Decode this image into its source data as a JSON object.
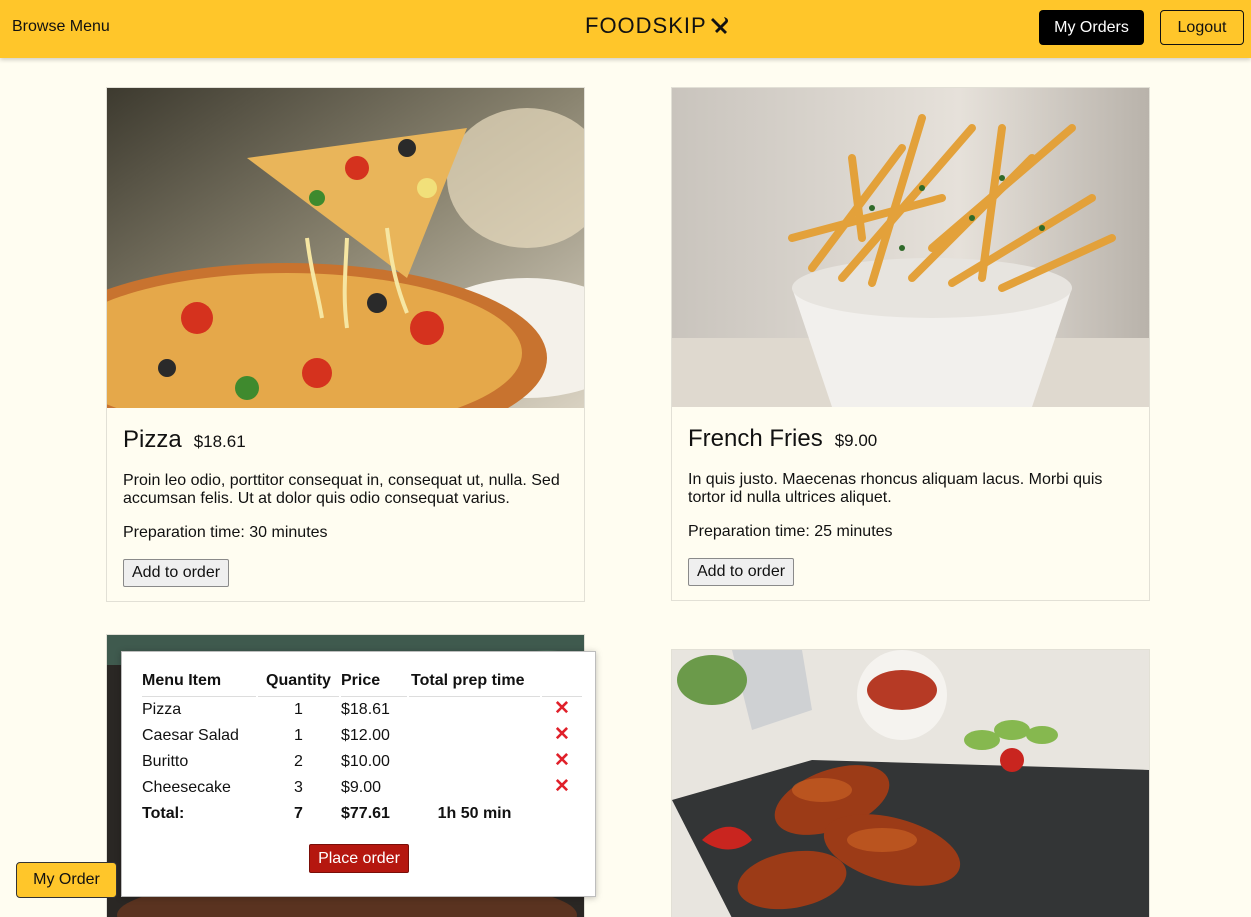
{
  "navbar": {
    "browse_label": "Browse Menu",
    "brand": "FOODSKIP",
    "my_orders_label": "My Orders",
    "logout_label": "Logout",
    "bg_color": "#ffc62a"
  },
  "menu": [
    {
      "name": "Pizza",
      "price": "$18.61",
      "description": "Proin leo odio, porttitor consequat in, consequat ut, nulla. Sed accumsan felis. Ut at dolor quis odio consequat varius.",
      "prep_time": "Preparation time: 30 minutes",
      "add_label": "Add to order",
      "image": "pizza-photo"
    },
    {
      "name": "French Fries",
      "price": "$9.00",
      "description": "In quis justo. Maecenas rhoncus aliquam lacus. Morbi quis tortor id nulla ultrices aliquet.",
      "prep_time": "Preparation time: 25 minutes",
      "add_label": "Add to order",
      "image": "fries-photo"
    },
    {
      "image": "steak-photo"
    },
    {
      "image": "chicken-wings-photo"
    }
  ],
  "order": {
    "headers": [
      "Menu Item",
      "Quantity",
      "Price",
      "Total prep time"
    ],
    "rows": [
      {
        "item": "Pizza",
        "qty": "1",
        "price": "$18.61"
      },
      {
        "item": "Caesar Salad",
        "qty": "1",
        "price": "$12.00"
      },
      {
        "item": "Buritto",
        "qty": "2",
        "price": "$10.00"
      },
      {
        "item": "Cheesecake",
        "qty": "3",
        "price": "$9.00"
      }
    ],
    "total": {
      "label": "Total:",
      "qty": "7",
      "price": "$77.61",
      "prep": "1h 50 min"
    },
    "remove_icon": "x-icon",
    "place_label": "Place order"
  },
  "floating": {
    "my_order_label": "My Order"
  }
}
